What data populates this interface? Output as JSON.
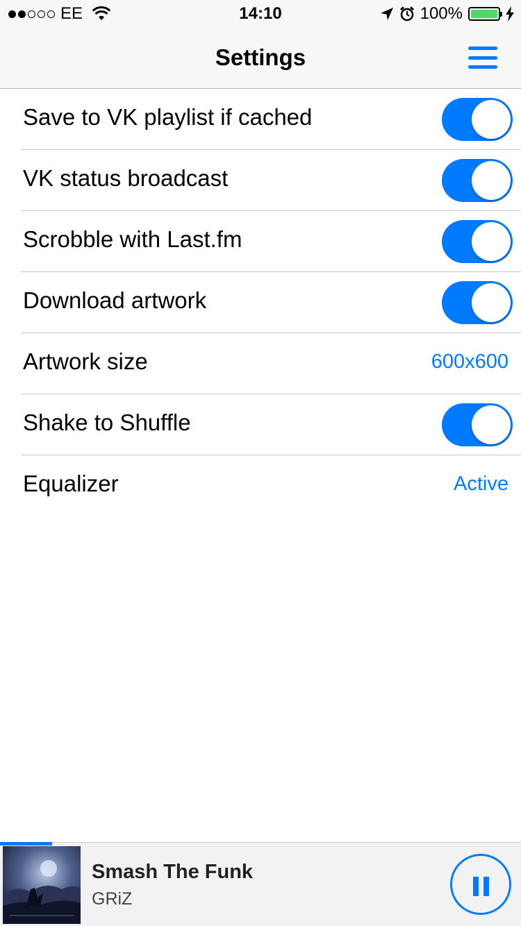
{
  "status_bar": {
    "signal_bars_filled": 2,
    "signal_bars_total": 5,
    "carrier": "EE",
    "time": "14:10",
    "battery": "100%",
    "icons": [
      "wifi-icon",
      "location-arrow-icon",
      "alarm-icon",
      "battery-icon",
      "charging-bolt-icon"
    ]
  },
  "nav": {
    "title": "Settings",
    "menu_icon": "hamburger-menu-icon"
  },
  "settings": {
    "items": [
      {
        "label": "Save to VK playlist if cached",
        "type": "toggle",
        "on": true
      },
      {
        "label": "VK status broadcast",
        "type": "toggle",
        "on": true
      },
      {
        "label": "Scrobble with Last.fm",
        "type": "toggle",
        "on": true
      },
      {
        "label": "Download artwork",
        "type": "toggle",
        "on": true
      },
      {
        "label": "Artwork size",
        "type": "value",
        "value": "600x600"
      },
      {
        "label": "Shake to Shuffle",
        "type": "toggle",
        "on": true
      },
      {
        "label": "Equalizer",
        "type": "value",
        "value": "Active"
      }
    ]
  },
  "player": {
    "title": "Smash The Funk",
    "artist": "GRiZ",
    "progress": 0.1,
    "state": "playing",
    "control_icon": "pause-icon"
  },
  "colors": {
    "accent": "#007aff",
    "toggle_on": "#007aff",
    "battery_fill": "#4cd964",
    "header_bg": "#f7f7f7",
    "player_bg": "#f2f2f2"
  }
}
